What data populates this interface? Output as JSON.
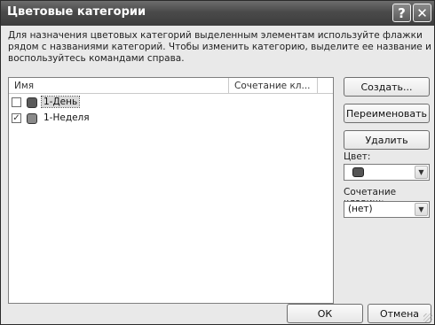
{
  "window": {
    "title": "Цветовые категории",
    "help_glyph": "?",
    "close_glyph": "✕"
  },
  "description": "Для назначения цветовых категорий выделенным элементам используйте флажки рядом с названиями категорий. Чтобы изменить категорию, выделите ее название и воспользуйтесь командами справа.",
  "list": {
    "columns": [
      "Имя",
      "Сочетание кл..."
    ],
    "items": [
      {
        "label": "1-День",
        "checked": false,
        "check_glyph": "",
        "color": "#5a5a5a",
        "selected": true
      },
      {
        "label": "1-Неделя",
        "checked": true,
        "check_glyph": "✓",
        "color": "#8a8a8a",
        "selected": false
      }
    ]
  },
  "buttons": {
    "create": "Создать...",
    "rename": "Переименовать",
    "delete": "Удалить",
    "ok": "ОК",
    "cancel": "Отмена"
  },
  "color_field": {
    "label": "Цвет:",
    "selected_color": "#555555"
  },
  "shortcut_field": {
    "label": "Сочетание клавиш:",
    "value": "(нет)"
  },
  "colors": {
    "titlebar": "#4a4a4a",
    "dialog_bg": "#e9e9e9"
  }
}
